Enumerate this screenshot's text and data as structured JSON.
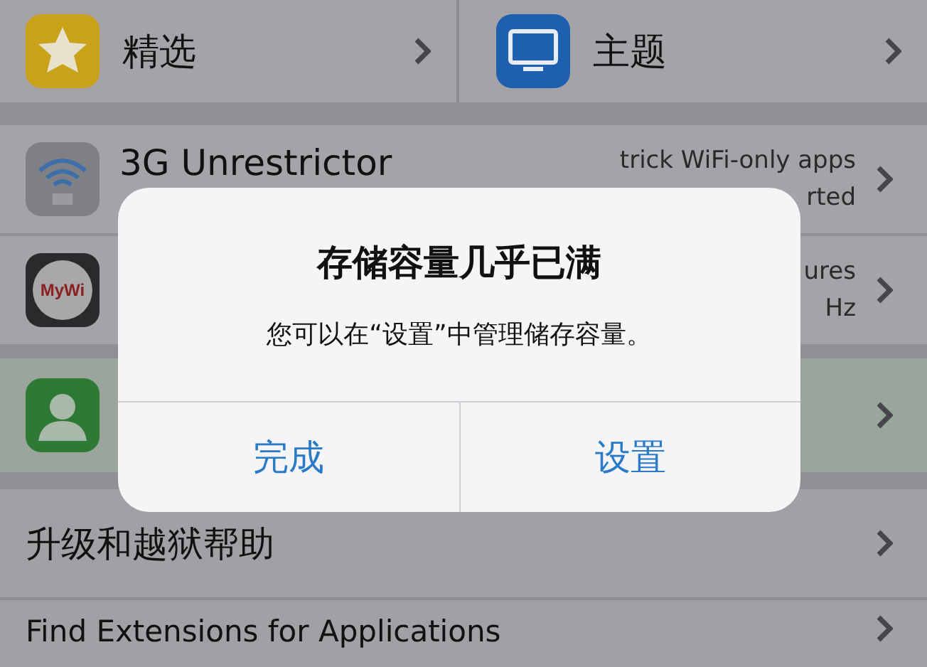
{
  "featured": [
    {
      "label": "精选"
    },
    {
      "label": "主题"
    }
  ],
  "packages": [
    {
      "kind": "wifi-app",
      "selected": false,
      "title": "3G Unrestrictor",
      "detail": [
        "trick WiFi-only apps",
        "rted"
      ]
    },
    {
      "kind": "mywi-app",
      "selected": false,
      "icon_text": "MyWi",
      "detail": [
        "ures",
        "Hz"
      ]
    },
    {
      "kind": "contact-app",
      "selected": true
    }
  ],
  "help_links": [
    {
      "label": "升级和越狱帮助"
    },
    {
      "label": "Find Extensions for Applications"
    }
  ],
  "alert": {
    "title": "存储容量几乎已满",
    "message": "您可以在“设置”中管理储存容量。",
    "buttons": [
      "完成",
      "设置"
    ]
  }
}
